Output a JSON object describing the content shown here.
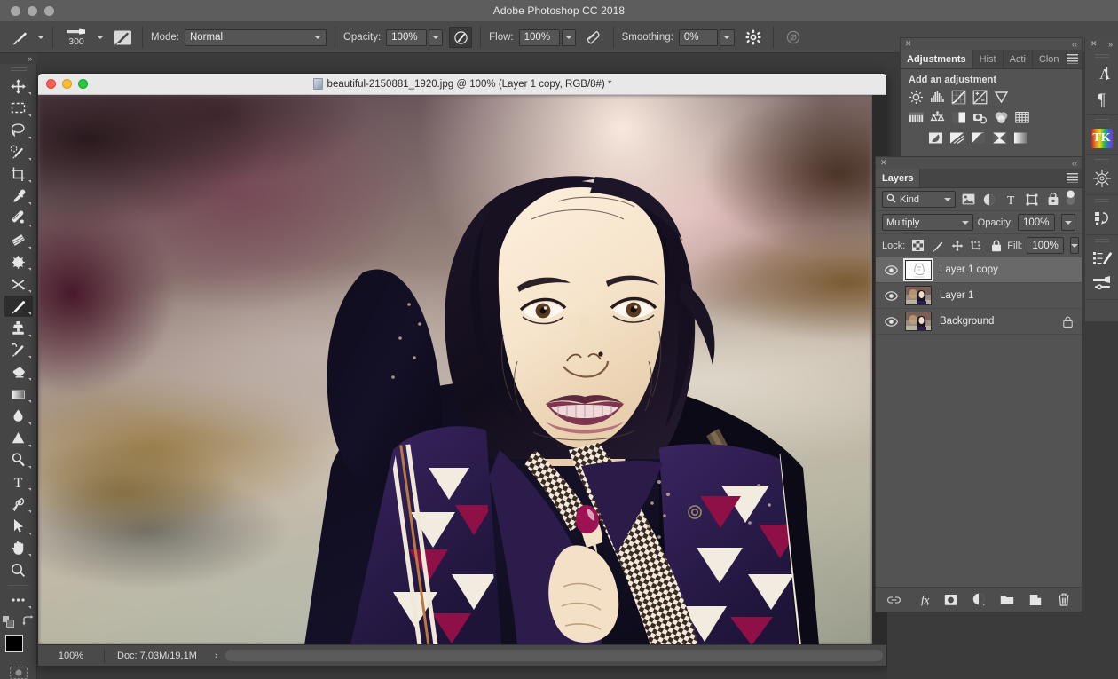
{
  "window": {
    "app_title": "Adobe Photoshop CC 2018",
    "traffic_lights": [
      "close-dot",
      "minimize-dot",
      "maximize-dot"
    ]
  },
  "options_bar": {
    "tool_preset_icon": "brush-preset-icon",
    "brush_size": "300",
    "brush_panel_icon": "brush-panel-icon",
    "mode_label": "Mode:",
    "mode_value": "Normal",
    "opacity_label": "Opacity:",
    "opacity_value": "100%",
    "pressure_opacity_icon": "airbrush-pressure-opacity-icon",
    "flow_label": "Flow:",
    "flow_value": "100%",
    "airbrush_icon": "airbrush-icon",
    "smoothing_label": "Smoothing:",
    "smoothing_value": "0%",
    "smoothing_options_icon": "gear-icon",
    "symmetry_icon": "symmetry-icon",
    "angle_icon": "brush-angle-icon"
  },
  "toolbar": {
    "collapse_label": "»",
    "tools": [
      {
        "name": "move-tool",
        "icon": "move-icon",
        "active": false,
        "has_flyout": true
      },
      {
        "name": "rectangular-marquee-tool",
        "icon": "rectangular-marquee-icon",
        "active": false,
        "has_flyout": true
      },
      {
        "name": "lasso-tool",
        "icon": "lasso-icon",
        "active": false,
        "has_flyout": true
      },
      {
        "name": "object-selection-tool",
        "icon": "quick-selection-icon",
        "active": false,
        "has_flyout": true
      },
      {
        "name": "crop-tool",
        "icon": "crop-icon",
        "active": false,
        "has_flyout": true
      },
      {
        "name": "eyedropper-tool",
        "icon": "eyedropper-icon",
        "active": false,
        "has_flyout": true
      },
      {
        "name": "spot-healing-brush-tool",
        "icon": "healing-brush-icon",
        "active": false,
        "has_flyout": true
      },
      {
        "name": "patch-tool",
        "icon": "patch-icon",
        "active": false,
        "has_flyout": true
      },
      {
        "name": "content-aware-move-tool",
        "icon": "content-aware-move-icon",
        "active": false,
        "has_flyout": true
      },
      {
        "name": "red-eye-tool",
        "icon": "red-eye-icon",
        "active": false,
        "has_flyout": true
      },
      {
        "name": "brush-tool",
        "icon": "brush-icon",
        "active": true,
        "has_flyout": true
      },
      {
        "name": "clone-stamp-tool",
        "icon": "clone-stamp-icon",
        "active": false,
        "has_flyout": true
      },
      {
        "name": "history-brush-tool",
        "icon": "history-brush-icon",
        "active": false,
        "has_flyout": true
      },
      {
        "name": "eraser-tool",
        "icon": "eraser-icon",
        "active": false,
        "has_flyout": true
      },
      {
        "name": "gradient-tool",
        "icon": "gradient-icon",
        "active": false,
        "has_flyout": true
      },
      {
        "name": "blur-tool",
        "icon": "blur-droplet-icon",
        "active": false,
        "has_flyout": true
      },
      {
        "name": "dodge-tool",
        "icon": "sharpen-triangle-icon",
        "active": false,
        "has_flyout": true
      },
      {
        "name": "burn-tool",
        "icon": "dodge-icon",
        "active": false,
        "has_flyout": true
      },
      {
        "name": "type-tool",
        "icon": "type-icon",
        "active": false,
        "has_flyout": true
      },
      {
        "name": "pen-tool",
        "icon": "pen-icon",
        "active": false,
        "has_flyout": true
      },
      {
        "name": "path-selection-tool",
        "icon": "path-selection-arrow-icon",
        "active": false,
        "has_flyout": true
      },
      {
        "name": "hand-tool",
        "icon": "hand-icon",
        "active": false,
        "has_flyout": true
      },
      {
        "name": "zoom-tool",
        "icon": "zoom-magnifier-icon",
        "active": false,
        "has_flyout": false
      },
      {
        "name": "edit-toolbar-button",
        "icon": "ellipsis-icon",
        "active": false,
        "has_flyout": true
      }
    ],
    "default_colors_icon": "default-colors-icon",
    "swap_colors_icon": "swap-colors-icon",
    "foreground_color": "#000000",
    "background_color": "#f4f4f4",
    "quick_mask_icon": "quick-mask-icon"
  },
  "document": {
    "title": "beautiful-2150881_1920.jpg @ 100% (Layer 1 copy, RGB/8#) *",
    "file_icon": "jpeg-file-icon",
    "traffic_lights": [
      "close-button",
      "minimize-button",
      "zoom-button"
    ],
    "status": {
      "zoom": "100%",
      "doc_info": "Doc: 7,03M/19,1M",
      "expand_arrow": "›"
    }
  },
  "adjustments_panel": {
    "close_icon": "close-icon",
    "collapse_icon": "collapse-panel-icon",
    "tabs": [
      {
        "label": "Adjustments",
        "active": true
      },
      {
        "label": "Hist",
        "active": false
      },
      {
        "label": "Acti",
        "active": false
      },
      {
        "label": "Clon",
        "active": false
      }
    ],
    "menu_icon": "panel-menu-icon",
    "heading": "Add an adjustment",
    "rows": [
      [
        "brightness-contrast-icon",
        "levels-icon",
        "curves-icon",
        "exposure-icon",
        "vibrance-icon"
      ],
      [
        "color-balance-icon",
        "hue-saturation-icon",
        "black-and-white-icon",
        "photo-filter-icon",
        "channel-mixer-icon",
        "color-lookup-icon"
      ],
      [
        "invert-icon",
        "posterize-icon",
        "threshold-icon",
        "selective-color-icon",
        "gradient-map-icon"
      ]
    ]
  },
  "layers_panel": {
    "close_icon": "close-icon",
    "collapse_icon": "collapse-panel-icon",
    "tab_label": "Layers",
    "menu_icon": "panel-menu-icon",
    "filter": {
      "search_icon": "search-icon",
      "kind_label": "Kind",
      "chevron_icon": "chevron-down-icon",
      "type_filters": [
        "filter-pixel-layers-icon",
        "filter-adjustment-layers-icon",
        "filter-type-layers-icon",
        "filter-shape-layers-icon",
        "filter-smart-objects-icon"
      ],
      "toggle_icon": "filter-toggle-icon"
    },
    "blend_mode": "Multiply",
    "opacity_label": "Opacity:",
    "opacity_value": "100%",
    "lock_label": "Lock:",
    "lock_icons": [
      "lock-transparent-pixels-icon",
      "lock-image-pixels-icon",
      "lock-position-icon",
      "lock-artboard-nesting-icon",
      "lock-all-icon"
    ],
    "fill_label": "Fill:",
    "fill_value": "100%",
    "layers": [
      {
        "name": "Layer 1 copy",
        "selected": true,
        "visible": true,
        "locked": false,
        "thumb": "sketch"
      },
      {
        "name": "Layer 1",
        "selected": false,
        "visible": true,
        "locked": false,
        "thumb": "photo"
      },
      {
        "name": "Background",
        "selected": false,
        "visible": true,
        "locked": true,
        "thumb": "photo"
      }
    ],
    "bottom_buttons": [
      "link-layers-icon",
      "add-layer-style-icon",
      "add-layer-mask-icon",
      "new-fill-adjustment-layer-icon",
      "new-group-icon",
      "new-layer-icon",
      "delete-layer-icon"
    ]
  },
  "icon_strip": {
    "close_icon": "close-icon",
    "expand_icon": "expand-panels-icon",
    "groups": [
      [
        "character-panel-icon",
        "paragraph-panel-icon"
      ],
      [
        "tk-actions-panel-icon"
      ],
      [
        "navigator-panel-icon"
      ],
      [
        "history-panel-icon"
      ],
      [
        "brush-settings-panel-icon",
        "brush-presets-panel-icon"
      ]
    ]
  },
  "colors": {
    "app_chrome": "#4a4a4a",
    "panel_bg": "#535353",
    "panel_tab_bg": "#454545",
    "selected_layer": "#696969",
    "titlebar": "#5d5d5d",
    "doc_titlebar": "#e8e8e8",
    "garment_purple": "#2a1f4a",
    "garment_magenta": "#8e1046",
    "skin": "#f3e2cc",
    "hair": "#140f1c"
  }
}
